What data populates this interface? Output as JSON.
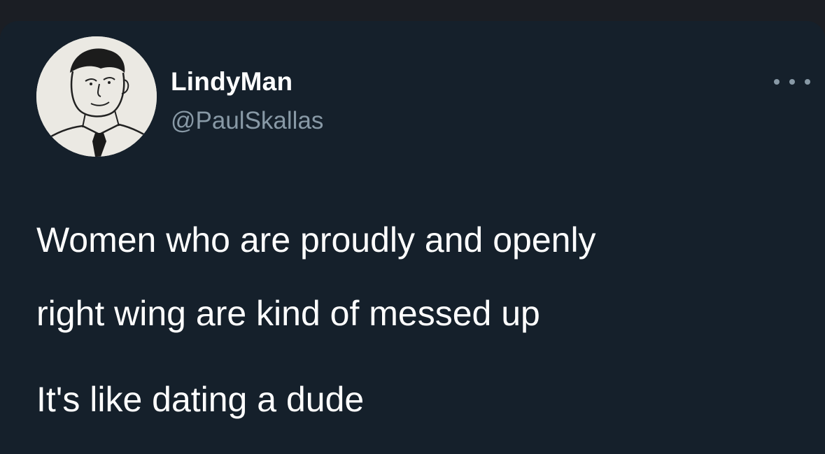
{
  "tweet": {
    "author": {
      "display_name": "LindyMan",
      "handle": "@PaulSkallas",
      "avatar_icon": "hand-drawn-portrait-avatar"
    },
    "more_icon": "ellipsis-horizontal-icon",
    "text_lines": [
      "Women who are proudly and openly",
      "right wing are kind of messed up",
      "It's like dating a dude"
    ]
  },
  "colors": {
    "background": "#15202b",
    "name": "#ffffff",
    "handle": "#8899a6",
    "text": "#ffffff"
  }
}
